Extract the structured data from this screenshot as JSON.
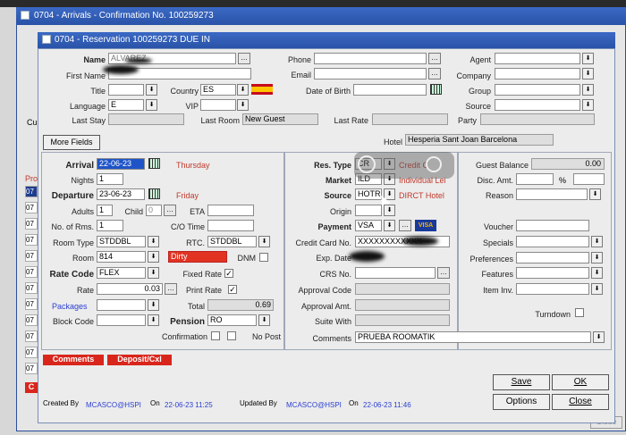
{
  "outer_title": "0704 - Arrivals - Confirmation No.  100259273",
  "dialog_title": "0704 - Reservation 100259273  DUE IN",
  "profile": {
    "name_label": "Name",
    "name": "ALVAREZ",
    "first_name_label": "First Name",
    "title_label": "Title",
    "country_label": "Country",
    "country": "ES",
    "language_label": "Language",
    "language": "E",
    "vip_label": "VIP",
    "last_stay_label": "Last Stay",
    "last_room_label": "Last Room",
    "last_room": "New Guest",
    "last_rate_label": "Last Rate",
    "phone_label": "Phone",
    "email_label": "Email",
    "dob_label": "Date of Birth",
    "agent_label": "Agent",
    "company_label": "Company",
    "group_label": "Group",
    "source_label": "Source",
    "party_label": "Party"
  },
  "more_fields": "More Fields",
  "hotel_label": "Hotel",
  "hotel": "Hesperia Sant Joan Barcelona",
  "stay": {
    "arrival_label": "Arrival",
    "arrival": "22-06-23",
    "arrival_day": "Thursday",
    "nights_label": "Nights",
    "nights": "1",
    "departure_label": "Departure",
    "departure": "23-06-23",
    "departure_day": "Friday",
    "adults_label": "Adults",
    "adults": "1",
    "child_label": "Child",
    "child": "0",
    "eta_label": "ETA",
    "rooms_label": "No. of Rms.",
    "rooms": "1",
    "co_time_label": "C/O Time",
    "room_type_label": "Room Type",
    "room_type": "STDDBL",
    "rtc_label": "RTC.",
    "rtc": "STDDBL",
    "room_label": "Room",
    "room": "814",
    "room_status": "Dirty",
    "dnm_label": "DNM",
    "rate_code_label": "Rate Code",
    "rate_code": "FLEX",
    "fixed_rate_label": "Fixed Rate",
    "rate_label": "Rate",
    "rate": "0.03",
    "print_rate_label": "Print Rate",
    "packages_label": "Packages",
    "total_label": "Total",
    "total": "0.69",
    "block_code_label": "Block Code",
    "pension_label": "Pension",
    "pension": "RO",
    "confirmation_label": "Confirmation",
    "no_post_label": "No Post"
  },
  "booking": {
    "res_type_label": "Res. Type",
    "res_type": "CR",
    "market_label": "Market",
    "market": "ILD",
    "market_desc": "Individual Lei",
    "source_label": "Source",
    "source": "HOTR",
    "source_desc": "DIRCT Hotel",
    "origin_label": "Origin",
    "payment_label": "Payment",
    "payment": "VSA",
    "card_brand": "VISA",
    "cc_label": "Credit Card No.",
    "cc": "XXXXXXXXXXXX",
    "exp_label": "Exp. Date",
    "crs_label": "CRS No.",
    "approval_code_label": "Approval Code",
    "approval_amt_label": "Approval Amt.",
    "suite_label": "Suite With",
    "comments_label": "Comments",
    "comments": "PRUEBA ROOMATIK",
    "res_type_desc": "Credit C"
  },
  "right": {
    "balance_label": "Guest Balance",
    "balance": "0.00",
    "disc_label": "Disc. Amt.",
    "pct": "%",
    "reason_label": "Reason",
    "voucher_label": "Voucher",
    "specials_label": "Specials",
    "preferences_label": "Preferences",
    "features_label": "Features",
    "item_inv_label": "Item Inv.",
    "turndown_label": "Turndown"
  },
  "red_buttons": {
    "comments": "Comments",
    "deposit": "Deposit/Cxl"
  },
  "footer": {
    "created_by_label": "Created By",
    "created_by": "MCASCO@HSPI",
    "on1": "On",
    "created_on": "22-06-23 11:25",
    "updated_by_label": "Updated By",
    "updated_by": "MCASCO@HSPI",
    "on2": "On",
    "updated_on": "22-06-23 11:46"
  },
  "buttons": {
    "save": "Save",
    "ok": "OK",
    "options": "Options",
    "close": "Close",
    "close_bg": "Close"
  },
  "side": {
    "cu": "Cu",
    "pro": "Pro",
    "rows": [
      "07",
      "07",
      "07",
      "07",
      "07",
      "07",
      "07",
      "07",
      "07",
      "07",
      "07",
      "07"
    ],
    "c": "C"
  }
}
